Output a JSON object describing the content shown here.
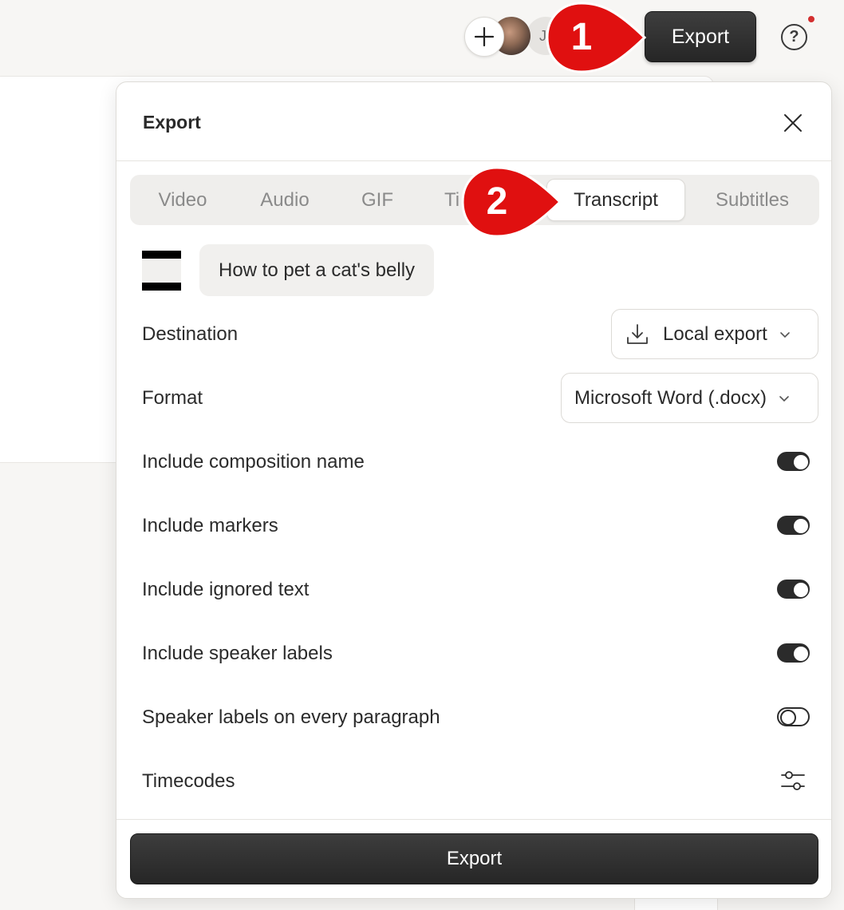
{
  "topbar": {
    "avatar_initial": "J",
    "export_label": "Export",
    "help_symbol": "?"
  },
  "dialog": {
    "title": "Export",
    "tabs": [
      {
        "label": "Video"
      },
      {
        "label": "Audio"
      },
      {
        "label": "GIF"
      },
      {
        "label": "Ti"
      },
      {
        "label": "Transcript"
      },
      {
        "label": "Subtitles"
      }
    ],
    "active_tab": "Transcript",
    "composition_name": "How to pet a cat's belly",
    "destination": {
      "label": "Destination",
      "value": "Local export"
    },
    "format": {
      "label": "Format",
      "value": "Microsoft Word (.docx)"
    },
    "toggles": [
      {
        "label": "Include composition name",
        "on": true
      },
      {
        "label": "Include markers",
        "on": true
      },
      {
        "label": "Include ignored text",
        "on": true
      },
      {
        "label": "Include speaker labels",
        "on": true
      },
      {
        "label": "Speaker labels on every paragraph",
        "on": false
      }
    ],
    "timecodes_label": "Timecodes",
    "export_button": "Export"
  },
  "annotations": [
    {
      "number": "1",
      "color": "#e01010"
    },
    {
      "number": "2",
      "color": "#e01010"
    }
  ]
}
